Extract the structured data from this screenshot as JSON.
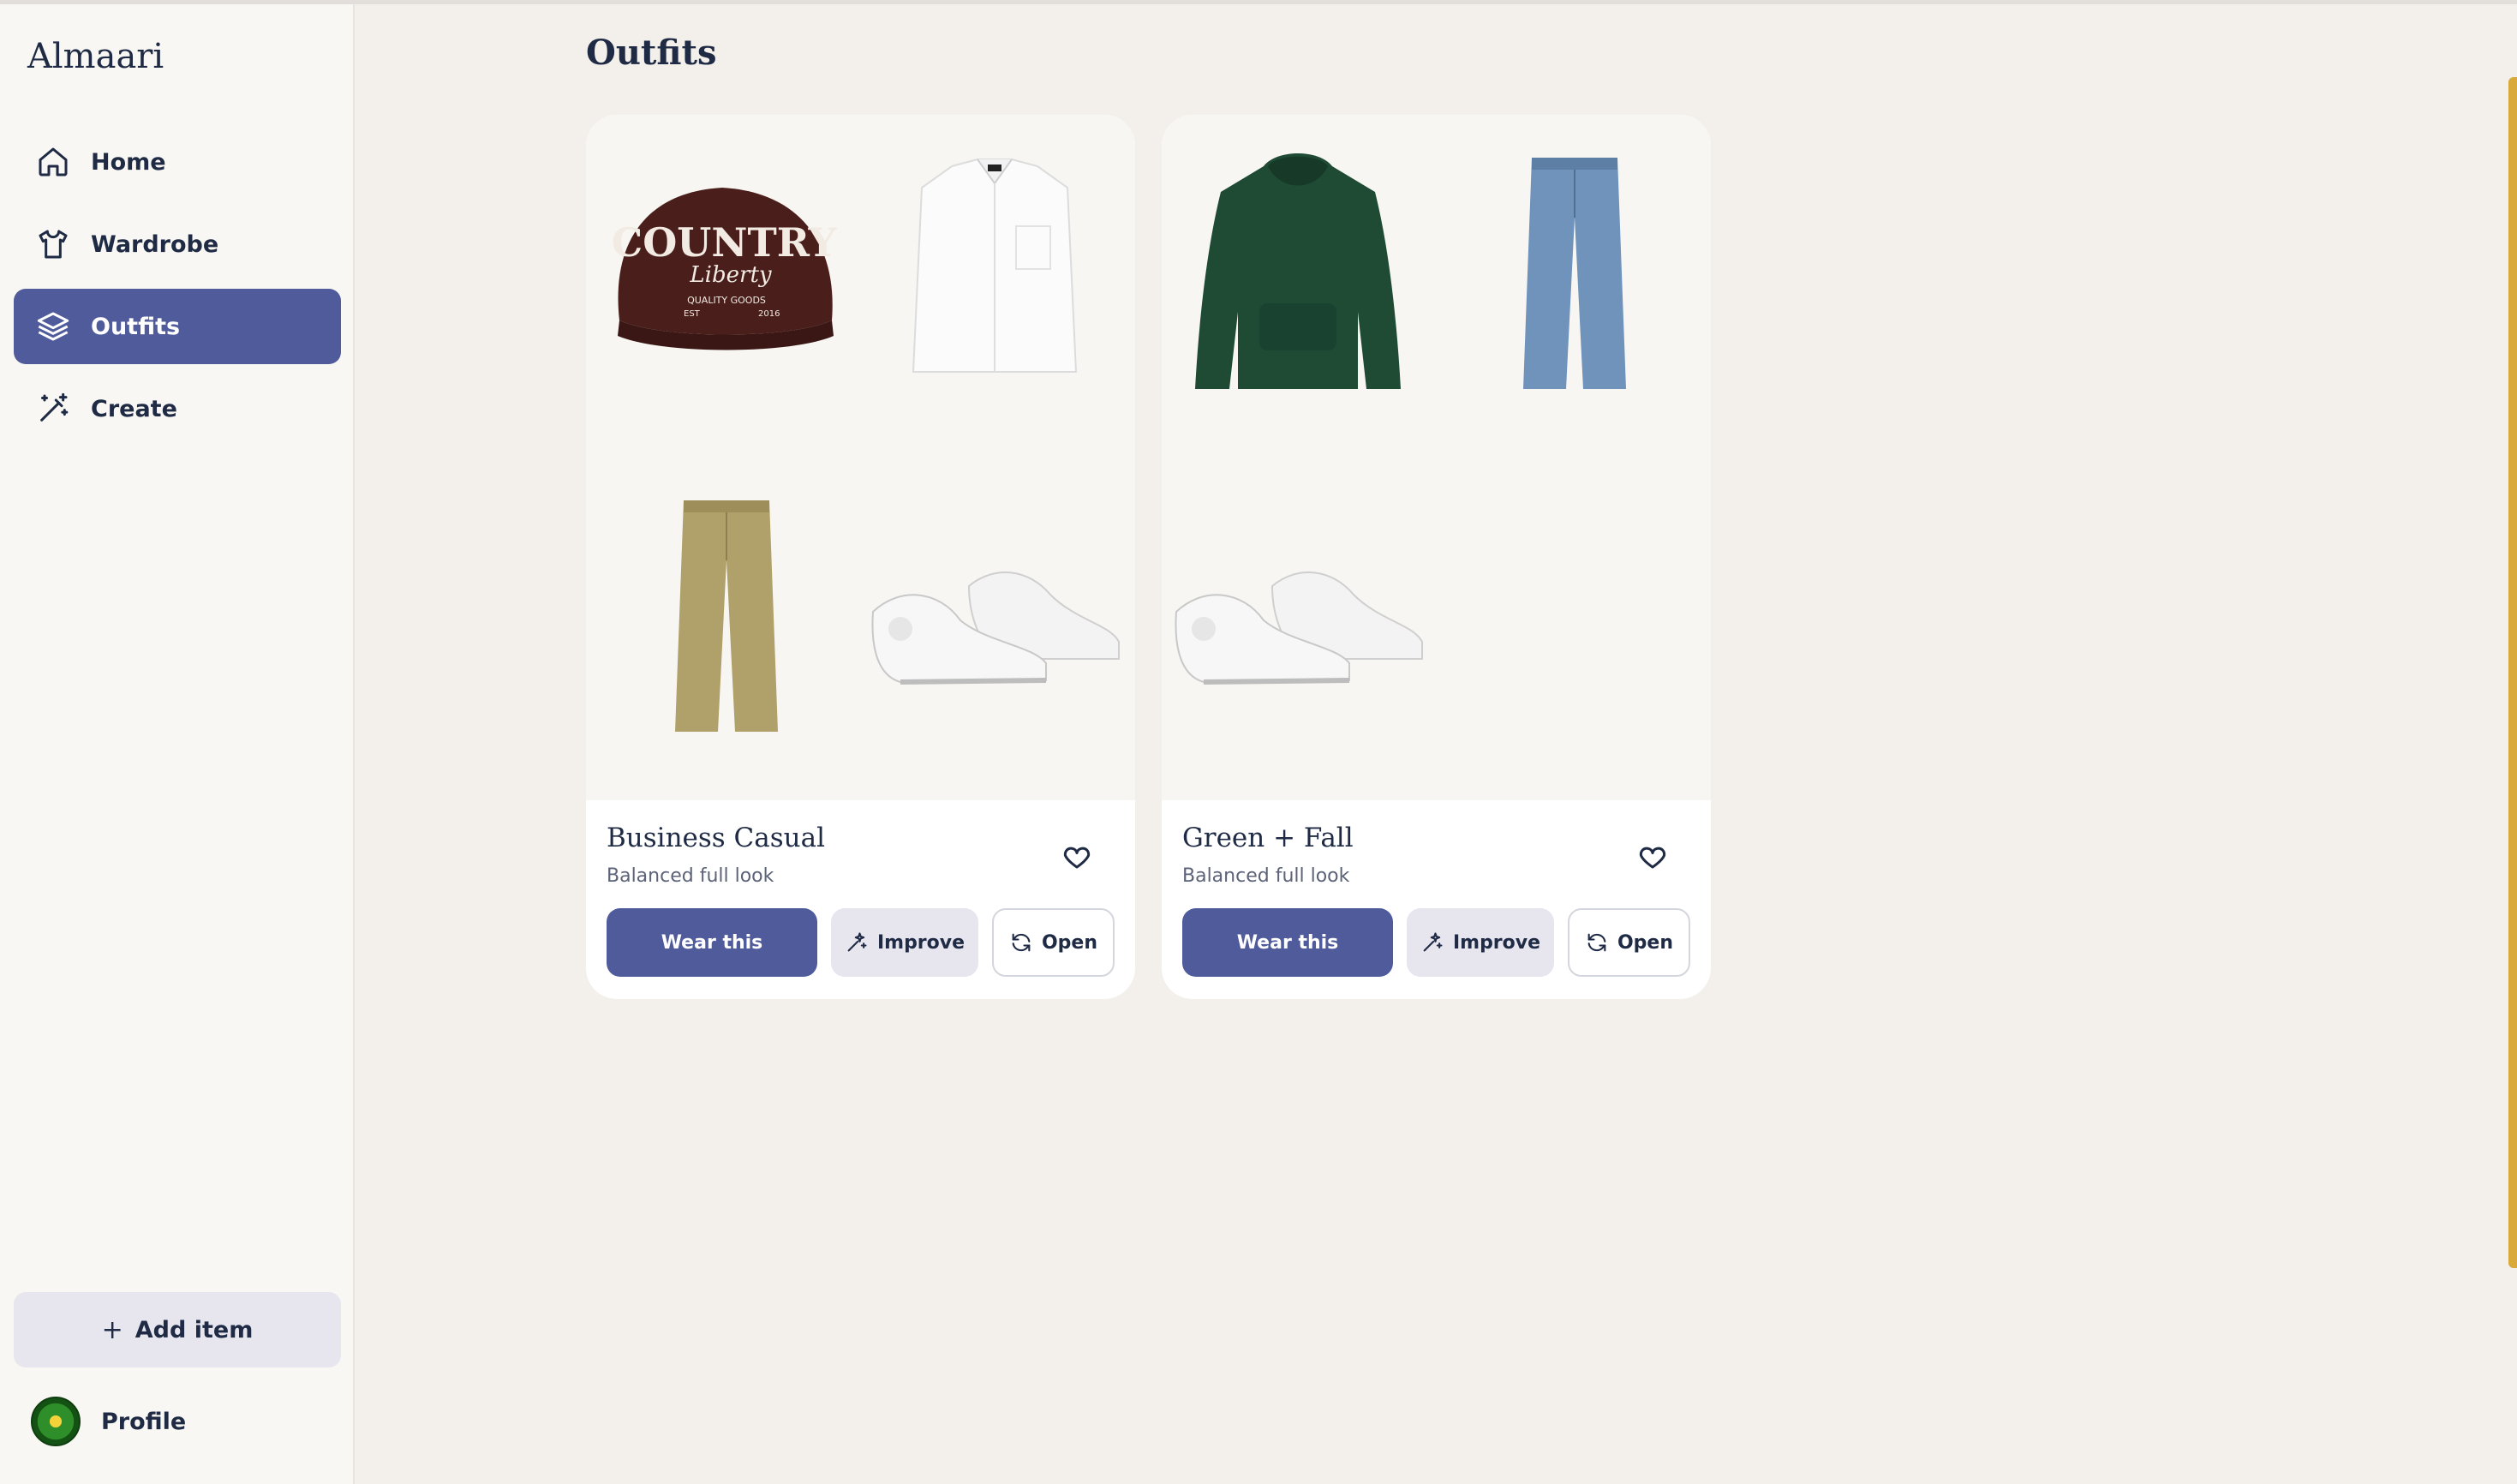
{
  "app": {
    "brand": "Almaari"
  },
  "sidebar": {
    "items": [
      {
        "label": "Home",
        "icon": "home-icon",
        "active": false
      },
      {
        "label": "Wardrobe",
        "icon": "shirt-icon",
        "active": false
      },
      {
        "label": "Outfits",
        "icon": "layers-icon",
        "active": true
      },
      {
        "label": "Create",
        "icon": "magic-wand-icon",
        "active": false
      }
    ],
    "add_item_label": "Add item",
    "profile_label": "Profile"
  },
  "main": {
    "title": "Outfits",
    "outfits": [
      {
        "title": "Business Casual",
        "subtitle": "Balanced full look",
        "items": [
          "brown-country-cap",
          "white-oxford-shirt",
          "khaki-chinos",
          "white-sneakers"
        ],
        "cap_text": {
          "line1": "COUNTRY",
          "line2": "Liberty",
          "line3": "QUALITY GOODS",
          "est": "EST",
          "year": "2016"
        },
        "wear_label": "Wear this",
        "improve_label": "Improve",
        "open_label": "Open"
      },
      {
        "title": "Green + Fall",
        "subtitle": "Balanced full look",
        "items": [
          "green-hoodie",
          "blue-jeans",
          "white-sneakers"
        ],
        "wear_label": "Wear this",
        "improve_label": "Improve",
        "open_label": "Open"
      }
    ]
  },
  "colors": {
    "accent": "#4f5b9a",
    "background": "#f3f0ec",
    "sidebar": "#f9f7f3",
    "text": "#1f2a44",
    "secondary_button": "#e7e6ef"
  }
}
